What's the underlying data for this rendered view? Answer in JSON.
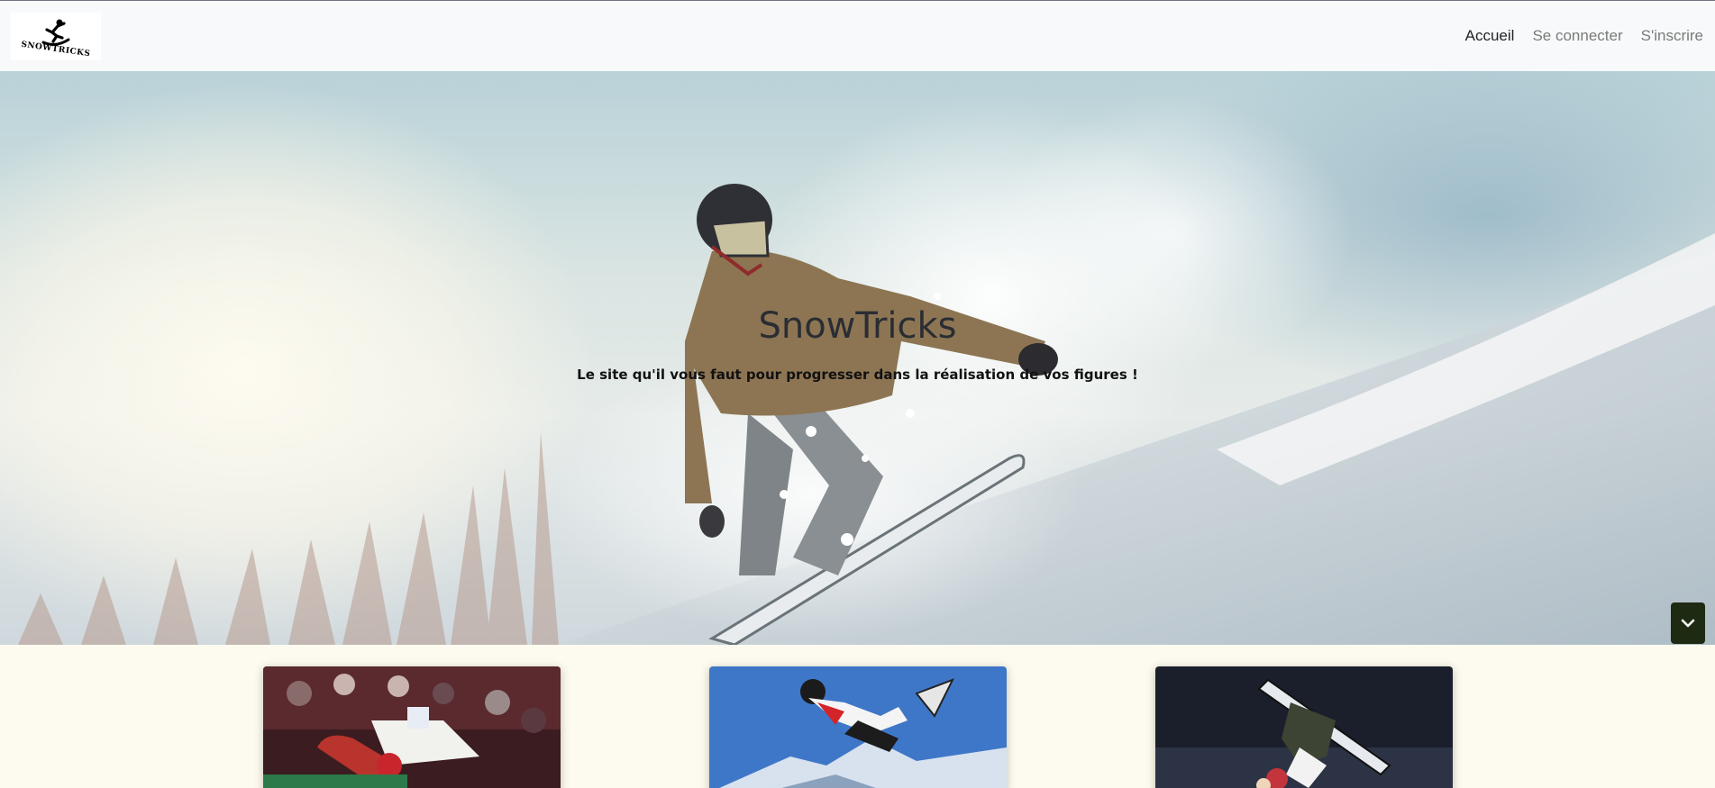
{
  "navbar": {
    "logo_text": "SNOWTRICKS",
    "links": [
      {
        "label": "Accueil",
        "active": true
      },
      {
        "label": "Se connecter",
        "active": false
      },
      {
        "label": "S'inscrire",
        "active": false
      }
    ]
  },
  "hero": {
    "title": "SnowTricks",
    "subtitle": "Le site qu'il vous faut pour progresser dans la réalisation de vos figures !",
    "scroll_icon": "chevron-down-icon"
  },
  "cards": [
    {
      "image": "snowboarder-halfpipe-crowd"
    },
    {
      "image": "snowboarder-blue-sky-jump"
    },
    {
      "image": "snowboarder-inverted-trick"
    }
  ],
  "colors": {
    "navbar_bg": "#f8f9fa",
    "page_bg": "#fdfbef",
    "scroll_button": "#1f2a12",
    "active_link": "#212529",
    "inactive_link": "#7a7a7a"
  }
}
